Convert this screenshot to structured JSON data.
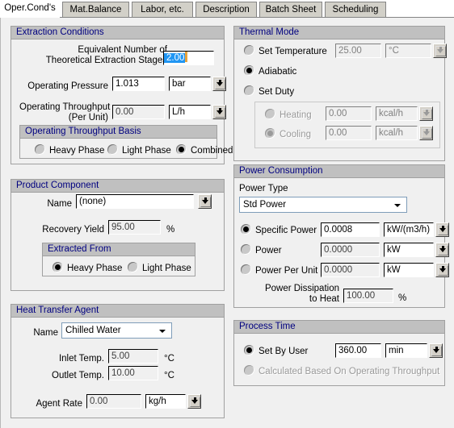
{
  "tabs": [
    {
      "label": "Oper.Cond's",
      "active": true
    },
    {
      "label": "Mat.Balance",
      "active": false
    },
    {
      "label": "Labor, etc.",
      "active": false
    },
    {
      "label": "Description",
      "active": false
    },
    {
      "label": "Batch Sheet",
      "active": false
    },
    {
      "label": "Scheduling",
      "active": false
    }
  ],
  "extraction_conditions": {
    "title": "Extraction Conditions",
    "stages_label_line1": "Equivalent Number of",
    "stages_label_line2": "Theoretical Extraction Stages",
    "stages_value": "2.00",
    "pressure_label": "Operating Pressure",
    "pressure_value": "1.013",
    "pressure_unit": "bar",
    "throughput_label_line1": "Operating Throughput",
    "throughput_label_line2": "(Per Unit)",
    "throughput_value": "0.00",
    "throughput_unit": "L/h",
    "basis": {
      "title": "Operating Throughput Basis",
      "options": [
        {
          "label": "Heavy Phase",
          "selected": false
        },
        {
          "label": "Light Phase",
          "selected": false
        },
        {
          "label": "Combined",
          "selected": true
        }
      ]
    }
  },
  "product_component": {
    "title": "Product Component",
    "name_label": "Name",
    "name_value": "(none)",
    "recovery_label": "Recovery Yield",
    "recovery_value": "95.00",
    "recovery_unit": "%",
    "extracted_from": {
      "title": "Extracted From",
      "options": [
        {
          "label": "Heavy Phase",
          "selected": true
        },
        {
          "label": "Light Phase",
          "selected": false
        }
      ]
    }
  },
  "heat_transfer_agent": {
    "title": "Heat Transfer Agent",
    "name_label": "Name",
    "name_value": "Chilled Water",
    "inlet_label": "Inlet Temp.",
    "inlet_value": "5.00",
    "inlet_unit": "°C",
    "outlet_label": "Outlet Temp.",
    "outlet_value": "10.00",
    "outlet_unit": "°C",
    "agent_rate_label": "Agent Rate",
    "agent_rate_value": "0.00",
    "agent_rate_unit": "kg/h"
  },
  "thermal_mode": {
    "title": "Thermal Mode",
    "set_temperature_label": "Set Temperature",
    "set_temperature_selected": false,
    "temperature_value": "25.00",
    "temperature_unit": "°C",
    "adiabatic_label": "Adiabatic",
    "adiabatic_selected": true,
    "set_duty_label": "Set Duty",
    "set_duty_selected": false,
    "heating_label": "Heating",
    "heating_selected": false,
    "heating_value": "0.00",
    "heating_unit": "kcal/h",
    "cooling_label": "Cooling",
    "cooling_selected": true,
    "cooling_value": "0.00",
    "cooling_unit": "kcal/h"
  },
  "power_consumption": {
    "title": "Power Consumption",
    "power_type_label": "Power Type",
    "power_type_value": "Std Power",
    "specific_power_label": "Specific Power",
    "specific_power_selected": true,
    "specific_power_value": "0.0008",
    "specific_power_unit": "kW/(m3/h)",
    "power_label": "Power",
    "power_selected": false,
    "power_value": "0.0000",
    "power_unit": "kW",
    "power_per_unit_label": "Power Per Unit",
    "power_per_unit_selected": false,
    "power_per_unit_value": "0.0000",
    "power_per_unit_unit": "kW",
    "dissipation_label_line1": "Power Dissipation",
    "dissipation_label_line2": "to Heat",
    "dissipation_value": "100.00",
    "dissipation_unit": "%"
  },
  "process_time": {
    "title": "Process Time",
    "set_by_user_label": "Set By User",
    "set_by_user_selected": true,
    "time_value": "360.00",
    "time_unit": "min",
    "calculated_label": "Calculated Based On Operating Throughput",
    "calculated_selected": false
  }
}
